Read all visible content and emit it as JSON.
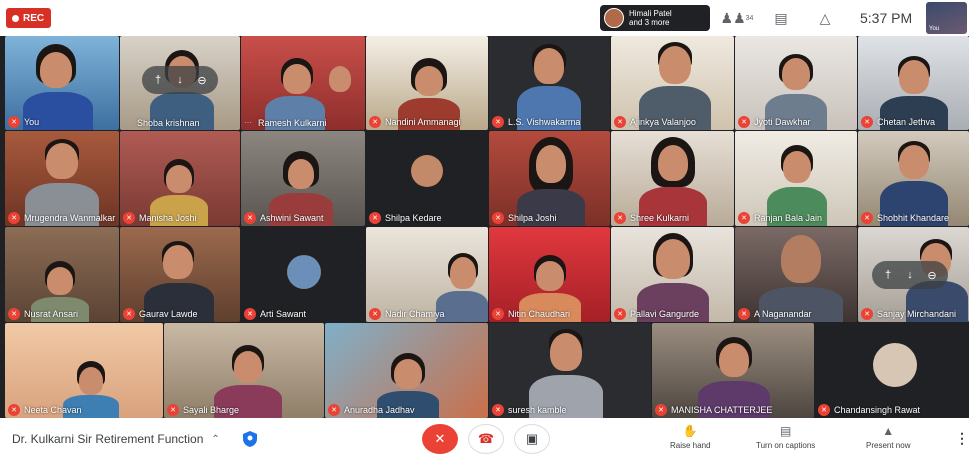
{
  "recording": {
    "label": "REC"
  },
  "presenter": {
    "line1": "Himali Patel",
    "line2": "and 3 more"
  },
  "top_controls": {
    "people_count": "34",
    "clock": "5:37 PM",
    "self_label": "You"
  },
  "tiles": [
    {
      "name": "You"
    },
    {
      "name": "Shoba krishnan"
    },
    {
      "name": "Ramesh Kulkarni"
    },
    {
      "name": "Nandini Ammanagi"
    },
    {
      "name": "L.S. Vishwakarma"
    },
    {
      "name": "Ajinkya Valanjoo"
    },
    {
      "name": "Jyoti Dawkhar"
    },
    {
      "name": "Chetan Jethva"
    },
    {
      "name": "Mrugendra Wanmalkar"
    },
    {
      "name": "Manisha Joshi"
    },
    {
      "name": "Ashwini Sawant"
    },
    {
      "name": "Shilpa Kedare"
    },
    {
      "name": "Shilpa Joshi"
    },
    {
      "name": "Shree Kulkarni"
    },
    {
      "name": "Ranjan Bala Jain"
    },
    {
      "name": "Shobhit Khandare"
    },
    {
      "name": "Nusrat Ansari"
    },
    {
      "name": "Gaurav Lawde"
    },
    {
      "name": "Arti Sawant"
    },
    {
      "name": "Nadir Chamiya"
    },
    {
      "name": "Nitin Chaudhari"
    },
    {
      "name": "Pallavi Gangurde"
    },
    {
      "name": "A Naganandar"
    },
    {
      "name": "Sanjay Mirchandani"
    },
    {
      "name": "Neeta Chavan"
    },
    {
      "name": "Sayali Bharge"
    },
    {
      "name": "Anuradha Jadhav"
    },
    {
      "name": "suresh kamble"
    },
    {
      "name": "MANISHA CHATTERJEE"
    },
    {
      "name": "Chandansingh Rawat"
    }
  ],
  "bottom": {
    "meeting_title": "Dr. Kulkarni Sir Retirement Function",
    "raise_hand": "Raise hand",
    "captions": "Turn on captions",
    "present_now": "Present now"
  },
  "colors": {
    "accent_red": "#ea4335",
    "meet_dark": "#202124",
    "wave_blue": "#8ab4f8"
  },
  "icons": [
    "record-icon",
    "people-icon",
    "chat-icon",
    "activities-icon",
    "mic-off-icon",
    "hang-up-icon",
    "camera-icon",
    "hand-icon",
    "captions-icon",
    "present-icon",
    "more-icon",
    "shield-icon",
    "chevron-up-icon",
    "pin-icon"
  ]
}
